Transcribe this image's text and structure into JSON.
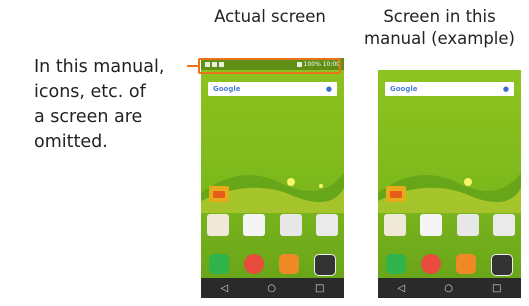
{
  "note_lines": [
    "In this manual,",
    "icons, etc. of",
    "a screen are",
    "omitted."
  ],
  "captions": {
    "actual": "Actual screen",
    "manual_line1": "Screen in this",
    "manual_line2": "manual (example)"
  },
  "phone": {
    "search_brand": "Google",
    "status_right": "100% 10:00"
  },
  "colors": {
    "accent": "#e8731a",
    "wallpaper": "#7cb81c"
  }
}
